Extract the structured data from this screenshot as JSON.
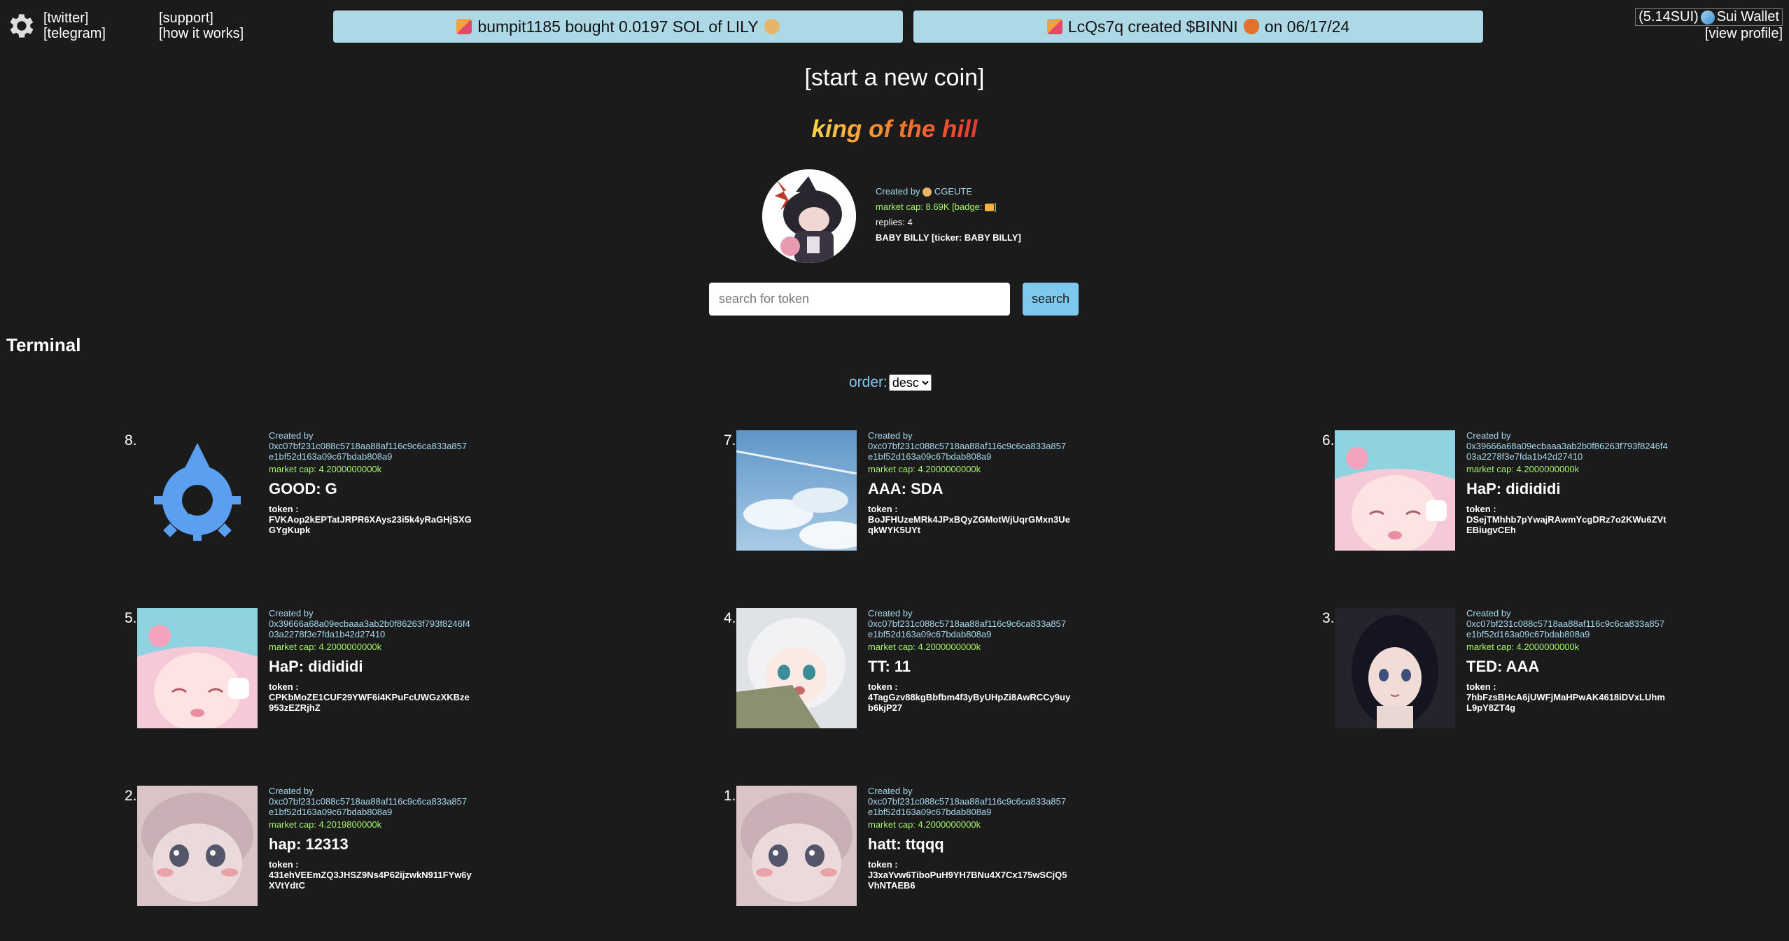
{
  "header": {
    "links_col1": [
      "[twitter]",
      "[telegram]"
    ],
    "links_col2": [
      "[support]",
      "[how it works]"
    ],
    "ticker1": "bumpit1185 bought 0.0197 SOL of LILY",
    "ticker2": "LcQs7q created $BINNI",
    "ticker2_date": "on 06/17/24",
    "wallet_balance": "(5.14SUI)",
    "wallet_label": "Sui Wallet",
    "view_profile": "[view profile]"
  },
  "start_new_coin": "[start a new coin]",
  "king": {
    "title": "king of the hill",
    "created_by_label": "Created by",
    "creator": "CGEUTE",
    "market_cap": "market cap: 8.69K [badge:",
    "market_cap_close": "]",
    "replies": "replies: 4",
    "name_ticker": "BABY BILLY [ticker: BABY BILLY]"
  },
  "search": {
    "placeholder": "search for token",
    "button": "search"
  },
  "terminal_title": "Terminal",
  "order": {
    "label": "order:",
    "selected": "desc",
    "options": [
      "desc"
    ]
  },
  "cards": [
    {
      "num": "8.",
      "created_label": "Created by",
      "address": "0xc07bf231c088c5718aa88af116c9c6ca833a857e1bf52d163a09c67bdab808a9",
      "market_cap": "market cap: 4.2000000000k",
      "name": "GOOD: G",
      "token_label": "token :",
      "token": "FVKAop2kEPTatJRPR6XAys23i5k4yRaGHjSXGGYgKupk",
      "thumb": "sui-logo"
    },
    {
      "num": "7.",
      "created_label": "Created by",
      "address": "0xc07bf231c088c5718aa88af116c9c6ca833a857e1bf52d163a09c67bdab808a9",
      "market_cap": "market cap: 4.2000000000k",
      "name": "AAA: SDA",
      "token_label": "token :",
      "token": "BoJFHUzeMRk4JPxBQyZGMotWjUqrGMxn3UeqkWYK5UYt",
      "thumb": "sky"
    },
    {
      "num": "6.",
      "created_label": "Created by",
      "address": "0x39666a68a09ecbaaa3ab2b0f86263f793f8246f403a2278f3e7fda1b42d27410",
      "market_cap": "market cap: 4.2000000000k",
      "name": "HaP: didididi",
      "token_label": "token :",
      "token": "DSejTMhhb7pYwajRAwmYcgDRz7o2KWu6ZVtEBiugvCEh",
      "thumb": "anime-pink"
    },
    {
      "num": "5.",
      "created_label": "Created by",
      "address": "0x39666a68a09ecbaaa3ab2b0f86263f793f8246f403a2278f3e7fda1b42d27410",
      "market_cap": "market cap: 4.2000000000k",
      "name": "HaP: didididi",
      "token_label": "token :",
      "token": "CPKbMoZE1CUF29YWF6i4KPuFcUWGzXKBze953zEZRjhZ",
      "thumb": "anime-pink"
    },
    {
      "num": "4.",
      "created_label": "Created by",
      "address": "0xc07bf231c088c5718aa88af116c9c6ca833a857e1bf52d163a09c67bdab808a9",
      "market_cap": "market cap: 4.2000000000k",
      "name": "TT: 11",
      "token_label": "token :",
      "token": "4TagGzv88kgBbfbm4f3yByUHpZi8AwRCCy9uyb6kjP27",
      "thumb": "anime-white"
    },
    {
      "num": "3.",
      "created_label": "Created by",
      "address": "0xc07bf231c088c5718aa88af116c9c6ca833a857e1bf52d163a09c67bdab808a9",
      "market_cap": "market cap: 4.2000000000k",
      "name": "TED: AAA",
      "token_label": "token :",
      "token": "7hbFzsBHcA6jUWFjMaHPwAK4618iDVxLUhmL9pY8ZT4g",
      "thumb": "anime-dark"
    },
    {
      "num": "2.",
      "created_label": "Created by",
      "address": "0xc07bf231c088c5718aa88af116c9c6ca833a857e1bf52d163a09c67bdab808a9",
      "market_cap": "market cap: 4.2019800000k",
      "name": "hap: 12313",
      "token_label": "token :",
      "token": "431ehVEEmZQ3JHSZ9Ns4P62ijzwkN911FYw6yXVtYdtC",
      "thumb": "anime-soft"
    },
    {
      "num": "1.",
      "created_label": "Created by",
      "address": "0xc07bf231c088c5718aa88af116c9c6ca833a857e1bf52d163a09c67bdab808a9",
      "market_cap": "market cap: 4.2000000000k",
      "name": "hatt: ttqqq",
      "token_label": "token :",
      "token": "J3xaYvw6TiboPuH9YH7BNu4X7Cx175wSCjQ5VhNTAEB6",
      "thumb": "anime-soft"
    }
  ]
}
